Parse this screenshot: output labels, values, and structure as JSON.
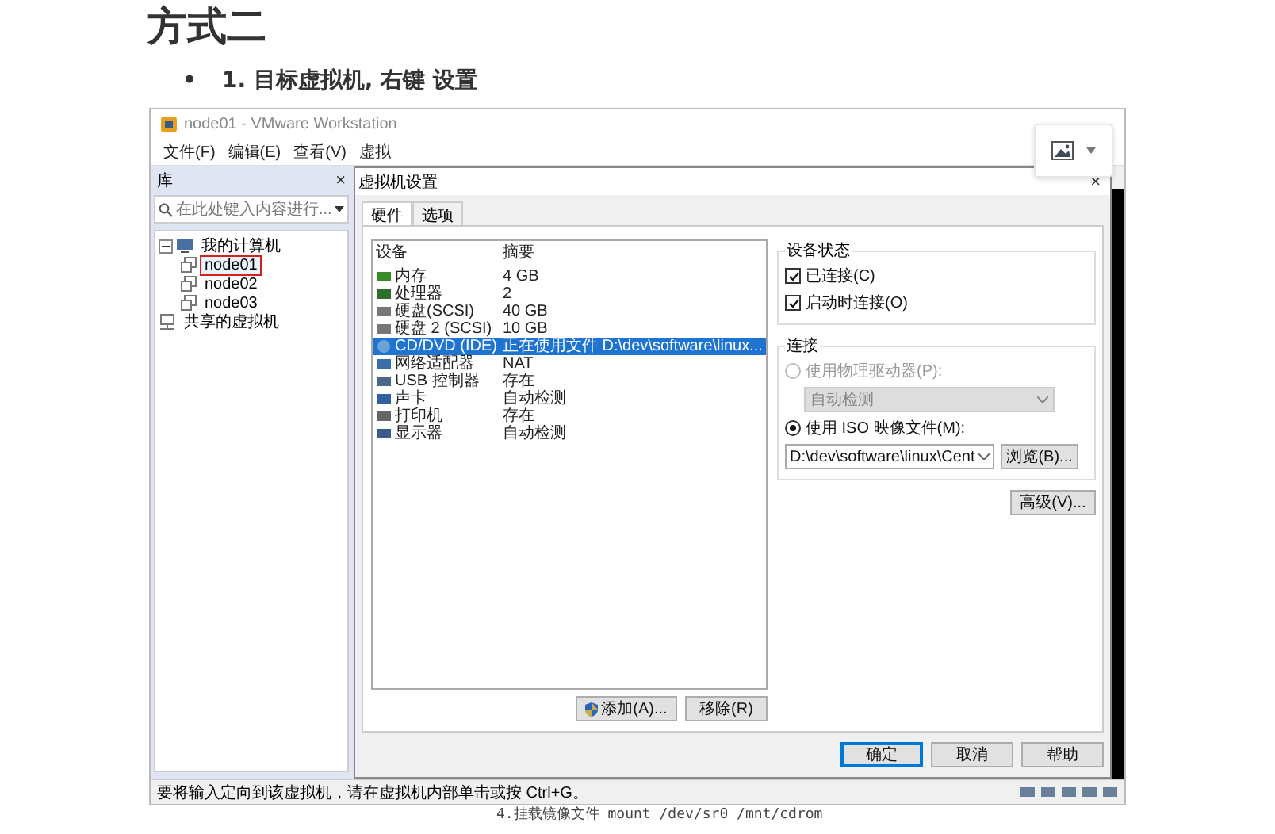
{
  "heading": "方式二",
  "bullets": [
    {
      "marker": "•",
      "text": "1. 目标虚拟机, 右键 设置"
    }
  ],
  "screenshot": {
    "window_title": "node01 - VMware Workstation",
    "menu": [
      "文件(F)",
      "编辑(E)",
      "查看(V)",
      "虚拟"
    ],
    "library": {
      "title": "库",
      "close": "×",
      "search_placeholder": "在此处键入内容进行...",
      "tree": [
        {
          "label": "我的计算机",
          "kind": "computer",
          "expanded": true,
          "children": [
            {
              "label": "node01",
              "kind": "vm",
              "selected": true
            },
            {
              "label": "node02",
              "kind": "vm",
              "selected": false
            },
            {
              "label": "node03",
              "kind": "vm",
              "selected": false
            }
          ]
        },
        {
          "label": "共享的虚拟机",
          "kind": "shared"
        }
      ]
    },
    "dialog": {
      "title": "虚拟机设置",
      "close": "×",
      "tabs": [
        {
          "label": "硬件",
          "selected": true
        },
        {
          "label": "选项",
          "selected": false
        }
      ],
      "device_columns": [
        "设备",
        "摘要"
      ],
      "devices": [
        {
          "name": "内存",
          "summary": "4 GB",
          "kind": "memory",
          "selected": false
        },
        {
          "name": "处理器",
          "summary": "2",
          "kind": "cpu",
          "selected": false
        },
        {
          "name": "硬盘(SCSI)",
          "summary": "40 GB",
          "kind": "disk",
          "selected": false
        },
        {
          "name": "硬盘 2 (SCSI)",
          "summary": "10 GB",
          "kind": "disk",
          "selected": false
        },
        {
          "name": "CD/DVD (IDE)",
          "summary": "正在使用文件 D:\\dev\\software\\linux...",
          "kind": "cd",
          "selected": true
        },
        {
          "name": "网络适配器",
          "summary": "NAT",
          "kind": "network",
          "selected": false
        },
        {
          "name": "USB 控制器",
          "summary": "存在",
          "kind": "usb",
          "selected": false
        },
        {
          "name": "声卡",
          "summary": "自动检测",
          "kind": "sound",
          "selected": false
        },
        {
          "name": "打印机",
          "summary": "存在",
          "kind": "printer",
          "selected": false
        },
        {
          "name": "显示器",
          "summary": "自动检测",
          "kind": "display",
          "selected": false
        }
      ],
      "add_button": "添加(A)...",
      "remove_button": "移除(R)",
      "device_status": {
        "title": "设备状态",
        "options": [
          {
            "label": "已连接(C)",
            "checked": true
          },
          {
            "label": "启动时连接(O)",
            "checked": true
          }
        ]
      },
      "connection": {
        "title": "连接",
        "options": [
          {
            "label": "使用物理驱动器(P):",
            "selected": false,
            "disabled": true,
            "value": "自动检测"
          },
          {
            "label": "使用 ISO 映像文件(M):",
            "selected": true,
            "disabled": false,
            "value": "D:\\dev\\software\\linux\\Cent"
          }
        ],
        "browse_button": "浏览(B)..."
      },
      "advanced_button": "高级(V)...",
      "buttons": [
        {
          "label": "确定",
          "primary": true
        },
        {
          "label": "取消",
          "primary": false
        },
        {
          "label": "帮助",
          "primary": false
        }
      ]
    },
    "status_text": "要将输入定向到该虚拟机，请在虚拟机内部单击或按 Ctrl+G。"
  },
  "next_step": "4.挂载镜像文件 mount /dev/sr0 /mnt/cdrom"
}
